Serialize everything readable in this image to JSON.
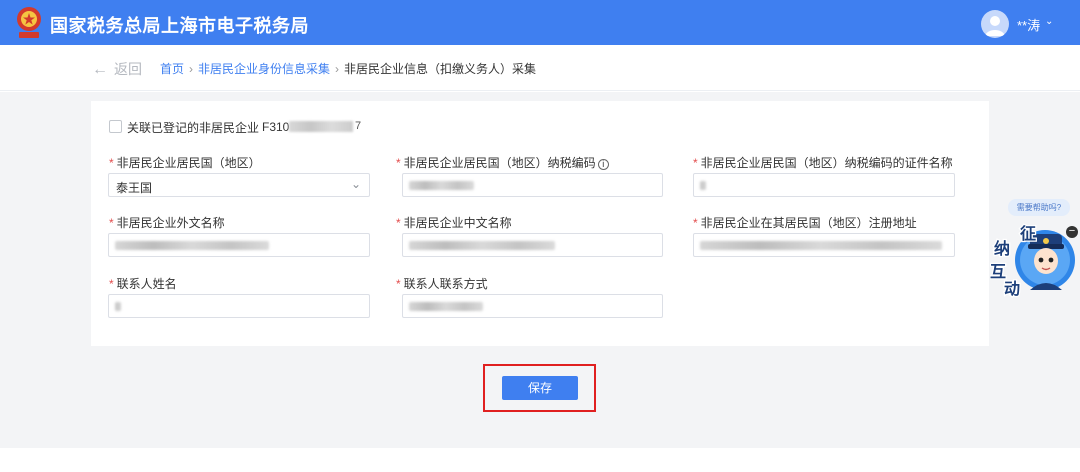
{
  "header": {
    "title": "国家税务总局上海市电子税务局",
    "user_name": "**涛",
    "user_caret": "⌄"
  },
  "breadcrumb": {
    "back_label": "返回",
    "items": [
      "首页",
      "非居民企业身份信息采集",
      "非居民企业信息（扣缴义务人）采集"
    ],
    "separator": "›"
  },
  "form": {
    "associate_label": "关联已登记的非居民企业",
    "associate_code": "F310",
    "associate_code_tail": "7",
    "associate_checked": false,
    "required_mark": "*",
    "fields": [
      {
        "label": "非居民企业居民国（地区）",
        "value": "泰王国",
        "type": "select"
      },
      {
        "label": "非居民企业居民国（地区）纳税编码",
        "value": "",
        "has_info_icon": true
      },
      {
        "label": "非居民企业居民国（地区）纳税编码的证件名称",
        "value": ""
      },
      {
        "label": "非居民企业外文名称",
        "value": ""
      },
      {
        "label": "非居民企业中文名称",
        "value": ""
      },
      {
        "label": "非居民企业在其居民国（地区）注册地址",
        "value": ""
      },
      {
        "label": "联系人姓名",
        "value": ""
      },
      {
        "label": "联系人联系方式",
        "value": ""
      }
    ],
    "info_icon": "i",
    "select_caret": "⌄"
  },
  "actions": {
    "save_label": "保存"
  },
  "helper": {
    "bubble_text": "需要帮助吗?",
    "chars": [
      "征",
      "纳",
      "互",
      "动"
    ],
    "minus_icon": "−"
  },
  "colors": {
    "brand": "#3f7ff0",
    "required": "#e34d4d",
    "highlight": "#e02020"
  }
}
